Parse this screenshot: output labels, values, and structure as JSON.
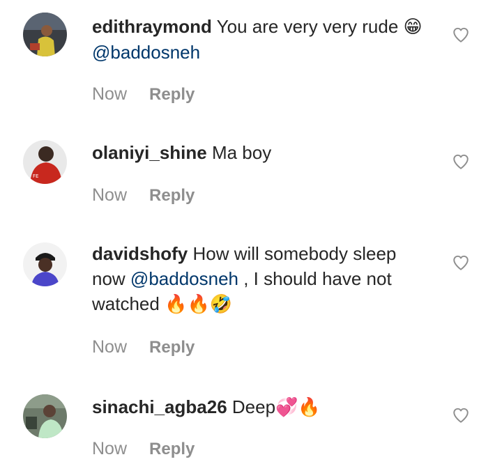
{
  "comments": [
    {
      "username": "edithraymond",
      "text_before": " You are very very rude ",
      "emoji_1": "😁",
      "mention": " @baddosneh",
      "text_after": "",
      "emoji_2": "",
      "time": "Now",
      "reply": "Reply",
      "avatar_icon": "profile-photo"
    },
    {
      "username": "olaniyi_shine",
      "text_before": " Ma boy",
      "emoji_1": "",
      "mention": "",
      "text_after": "",
      "emoji_2": "",
      "time": "Now",
      "reply": "Reply",
      "avatar_icon": "profile-photo"
    },
    {
      "username": "davidshofy",
      "text_before": " How will somebody sleep now ",
      "emoji_1": "",
      "mention": "@baddosneh",
      "text_after": " , I should have not watched ",
      "emoji_2": "🔥🔥🤣",
      "time": "Now",
      "reply": "Reply",
      "avatar_icon": "profile-photo"
    },
    {
      "username": "sinachi_agba26",
      "text_before": " Deep",
      "emoji_1": "",
      "mention": "",
      "text_after": "",
      "emoji_2": "💞🔥",
      "time": "Now",
      "reply": "Reply",
      "avatar_icon": "profile-photo"
    }
  ],
  "colors": {
    "text": "#262626",
    "muted": "#8e8e8e",
    "mention": "#00376b"
  },
  "icons": {
    "like": "heart-outline-icon"
  }
}
